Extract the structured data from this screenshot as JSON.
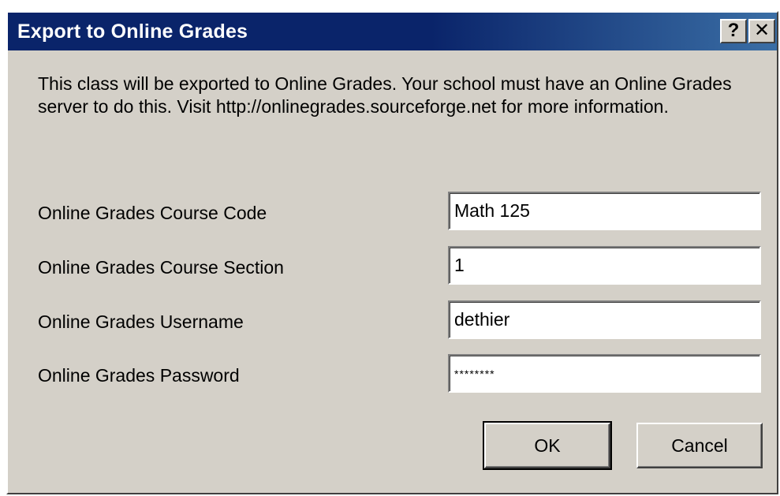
{
  "window": {
    "title": "Export to Online Grades",
    "help_glyph": "?",
    "close_glyph": "✕"
  },
  "description": "This class will be exported to Online Grades. Your school must have an Online Grades server to do this. Visit http://onlinegrades.sourceforge.net for more information.",
  "fields": [
    {
      "label": "Online Grades Course Code",
      "value": "Math 125"
    },
    {
      "label": "Online Grades Course Section",
      "value": "1"
    },
    {
      "label": "Online Grades Username",
      "value": "dethier"
    },
    {
      "label": "Online Grades Password",
      "value": "********"
    }
  ],
  "buttons": {
    "ok": "OK",
    "cancel": "Cancel"
  },
  "colors": {
    "titlebar": "#0a246a",
    "dialog_bg": "#d4d0c8"
  }
}
